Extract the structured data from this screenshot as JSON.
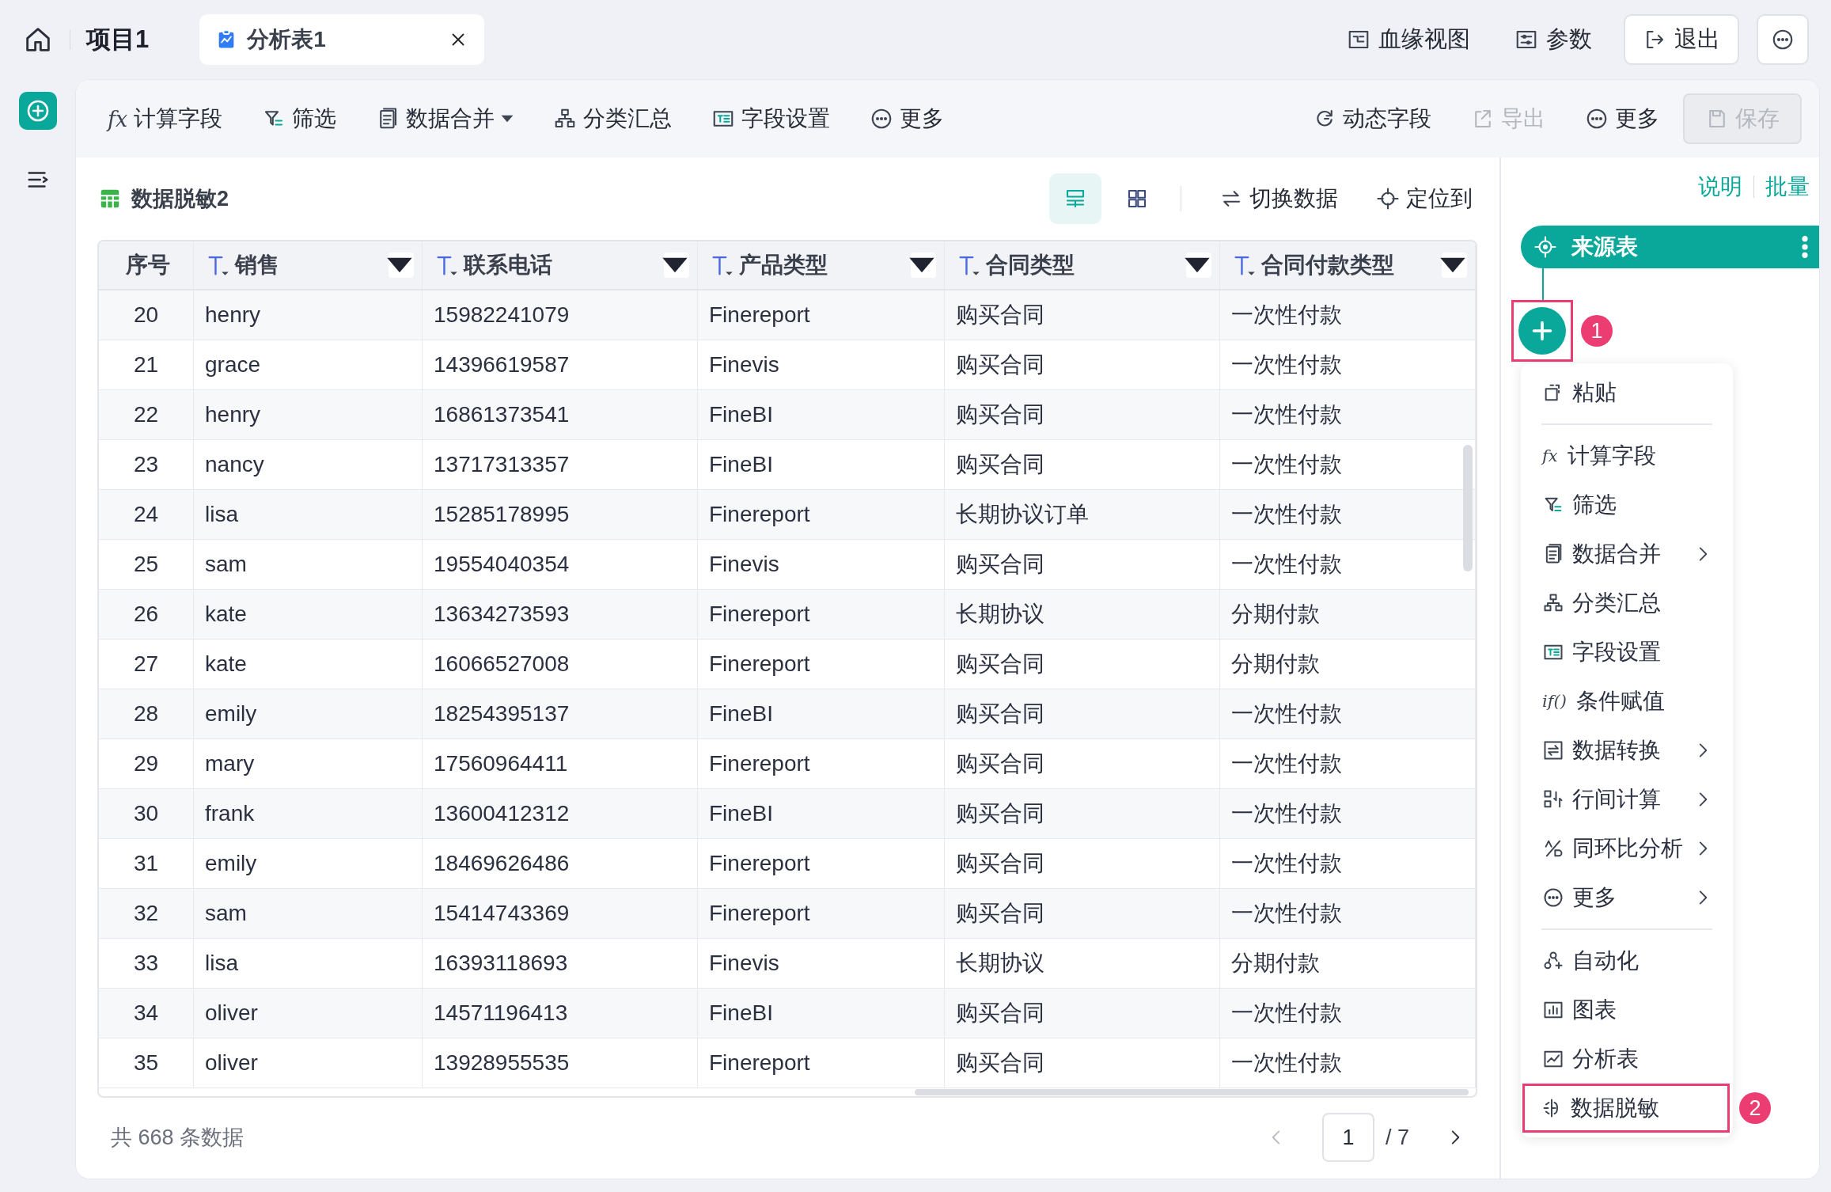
{
  "topbar": {
    "project": "项目1",
    "tabs": [
      {
        "label": "分析表1",
        "selected": true
      }
    ],
    "actions": [
      {
        "label": "血缘视图",
        "kind": "link"
      },
      {
        "label": "参数",
        "kind": "link"
      },
      {
        "label": "退出",
        "kind": "button"
      }
    ]
  },
  "toolbar": {
    "left": [
      {
        "label": "计算字段",
        "glyph": "fx",
        "dropdown": false
      },
      {
        "label": "筛选",
        "dropdown": false
      },
      {
        "label": "数据合并",
        "dropdown": true
      },
      {
        "label": "分类汇总",
        "dropdown": false
      },
      {
        "label": "字段设置",
        "dropdown": false
      },
      {
        "label": "更多",
        "dropdown": false
      }
    ],
    "right": [
      {
        "label": "动态字段",
        "kind": "link",
        "disabled": false
      },
      {
        "label": "导出",
        "kind": "link",
        "disabled": true
      },
      {
        "label": "更多",
        "kind": "link",
        "disabled": false
      },
      {
        "label": "保存",
        "kind": "button",
        "disabled": true
      }
    ]
  },
  "table_panel": {
    "title": "数据脱敏2",
    "views": [
      {
        "selected": true
      },
      {
        "selected": false
      }
    ],
    "actions": [
      "切换数据",
      "定位到"
    ],
    "columns": [
      {
        "label": "序号",
        "kind": "index"
      },
      {
        "label": "销售",
        "kind": "text"
      },
      {
        "label": "联系电话",
        "kind": "text"
      },
      {
        "label": "产品类型",
        "kind": "text"
      },
      {
        "label": "合同类型",
        "kind": "text"
      },
      {
        "label": "合同付款类型",
        "kind": "text"
      }
    ],
    "rows": [
      [
        "20",
        "henry",
        "15982241079",
        "Finereport",
        "购买合同",
        "一次性付款"
      ],
      [
        "21",
        "grace",
        "14396619587",
        "Finevis",
        "购买合同",
        "一次性付款"
      ],
      [
        "22",
        "henry",
        "16861373541",
        "FineBI",
        "购买合同",
        "一次性付款"
      ],
      [
        "23",
        "nancy",
        "13717313357",
        "FineBI",
        "购买合同",
        "一次性付款"
      ],
      [
        "24",
        "lisa",
        "15285178995",
        "Finereport",
        "长期协议订单",
        "一次性付款"
      ],
      [
        "25",
        "sam",
        "19554040354",
        "Finevis",
        "购买合同",
        "一次性付款"
      ],
      [
        "26",
        "kate",
        "13634273593",
        "Finereport",
        "长期协议",
        "分期付款"
      ],
      [
        "27",
        "kate",
        "16066527008",
        "Finereport",
        "购买合同",
        "分期付款"
      ],
      [
        "28",
        "emily",
        "18254395137",
        "FineBI",
        "购买合同",
        "一次性付款"
      ],
      [
        "29",
        "mary",
        "17560964411",
        "Finereport",
        "购买合同",
        "一次性付款"
      ],
      [
        "30",
        "frank",
        "13600412312",
        "FineBI",
        "购买合同",
        "一次性付款"
      ],
      [
        "31",
        "emily",
        "18469626486",
        "Finereport",
        "购买合同",
        "一次性付款"
      ],
      [
        "32",
        "sam",
        "15414743369",
        "Finereport",
        "购买合同",
        "一次性付款"
      ],
      [
        "33",
        "lisa",
        "16393118693",
        "Finevis",
        "长期协议",
        "分期付款"
      ],
      [
        "34",
        "oliver",
        "14571196413",
        "FineBI",
        "购买合同",
        "一次性付款"
      ],
      [
        "35",
        "oliver",
        "13928955535",
        "Finereport",
        "购买合同",
        "一次性付款"
      ]
    ],
    "total": "共 668 条数据",
    "pagination": {
      "page": "1",
      "pages": "/ 7",
      "prev_disabled": true,
      "next_disabled": false
    }
  },
  "flow": {
    "links": [
      "说明",
      "批量"
    ],
    "source_node": {
      "label": "来源表"
    },
    "add_button": {
      "highlighted": true,
      "badge": "1"
    },
    "menu": {
      "groups": [
        [
          {
            "label": "粘贴",
            "submenu": false,
            "highlighted": false
          }
        ],
        [
          {
            "label": "计算字段",
            "glyph": "fx",
            "submenu": false,
            "highlighted": false
          },
          {
            "label": "筛选",
            "submenu": false,
            "highlighted": false
          },
          {
            "label": "数据合并",
            "submenu": true,
            "highlighted": false
          },
          {
            "label": "分类汇总",
            "submenu": false,
            "highlighted": false
          },
          {
            "label": "字段设置",
            "submenu": false,
            "highlighted": false
          },
          {
            "label": "条件赋值",
            "glyph": "if()",
            "submenu": false,
            "highlighted": false
          },
          {
            "label": "数据转换",
            "submenu": true,
            "highlighted": false
          },
          {
            "label": "行间计算",
            "submenu": true,
            "highlighted": false
          },
          {
            "label": "同环比分析",
            "submenu": true,
            "highlighted": false
          },
          {
            "label": "更多",
            "submenu": true,
            "highlighted": false
          }
        ],
        [
          {
            "label": "自动化",
            "submenu": false,
            "highlighted": false
          },
          {
            "label": "图表",
            "submenu": false,
            "highlighted": false
          },
          {
            "label": "分析表",
            "submenu": false,
            "highlighted": false
          },
          {
            "label": "数据脱敏",
            "submenu": false,
            "highlighted": true,
            "badge": "2"
          }
        ]
      ]
    }
  }
}
